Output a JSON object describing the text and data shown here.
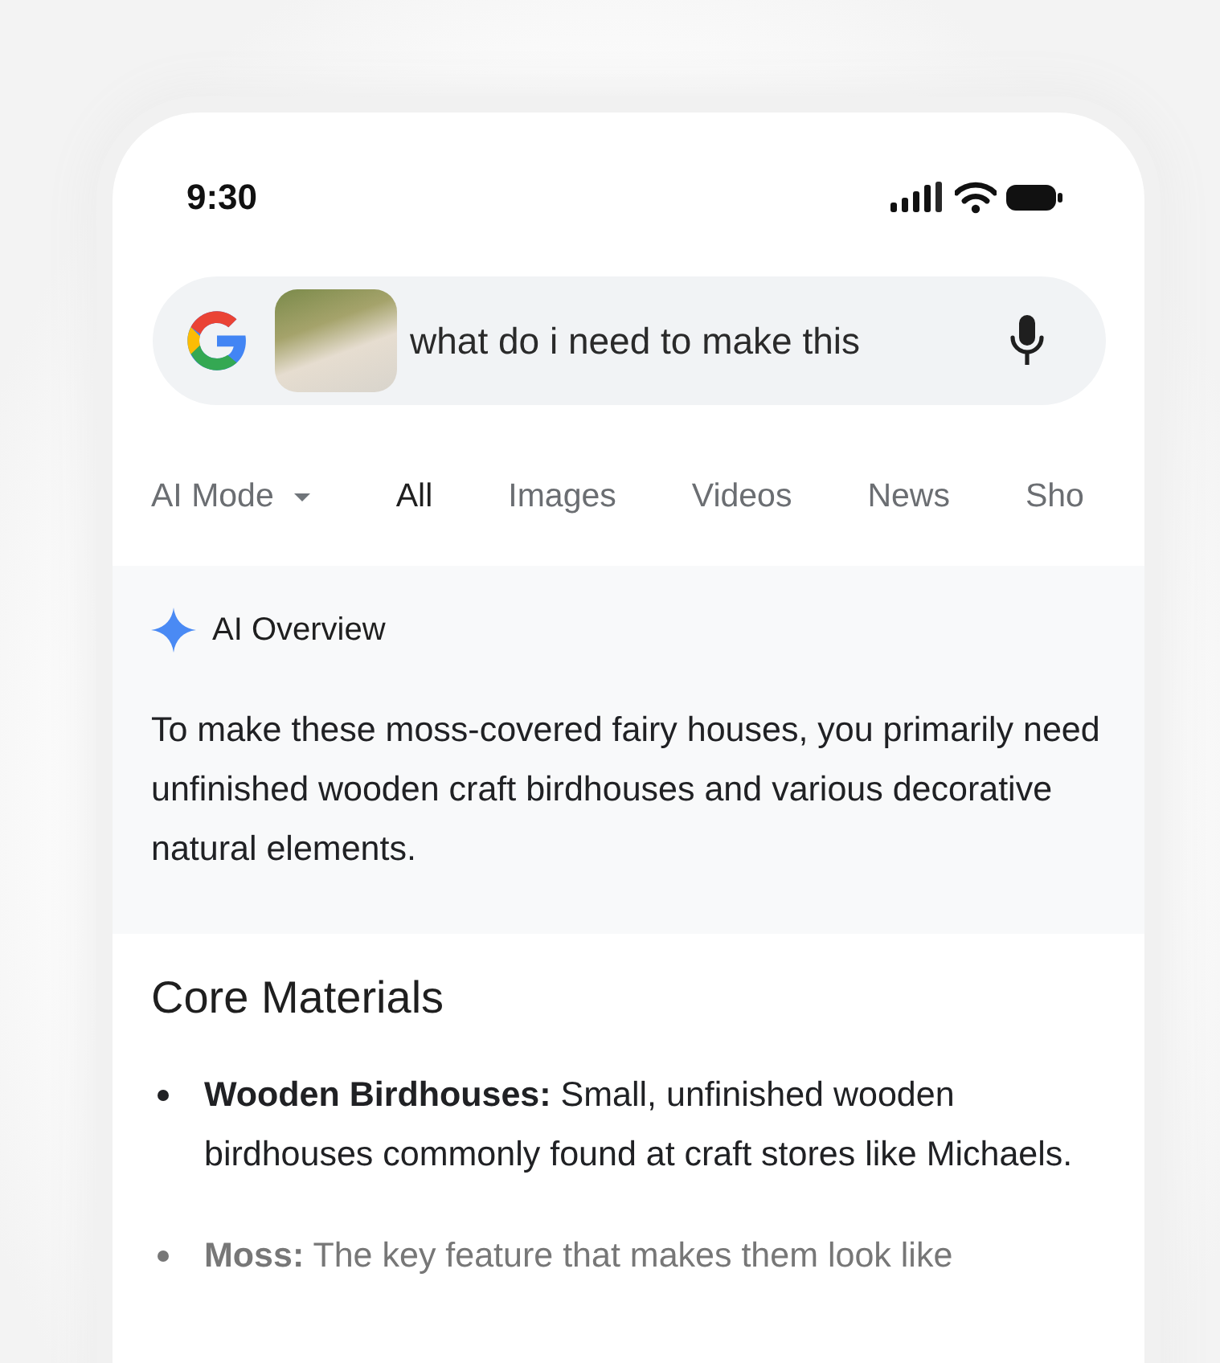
{
  "status_bar": {
    "time": "9:30"
  },
  "search": {
    "query": "what do i need to make this"
  },
  "tabs": [
    {
      "label": "AI Mode",
      "kind": "dropdown",
      "selected": false
    },
    {
      "label": "All",
      "kind": "tab",
      "selected": true
    },
    {
      "label": "Images",
      "kind": "tab",
      "selected": false
    },
    {
      "label": "Videos",
      "kind": "tab",
      "selected": false
    },
    {
      "label": "News",
      "kind": "tab",
      "selected": false
    },
    {
      "label": "Sho",
      "kind": "tab",
      "selected": false
    }
  ],
  "ai_overview": {
    "title": "AI Overview",
    "summary": "To make these moss-covered fairy houses, you primarily need unfinished wooden craft birdhouses and various decorative natural elements."
  },
  "section": {
    "heading": "Core Materials",
    "items": [
      {
        "text": "**Wooden Birdhouses:** Small, unfinished wooden birdhouses commonly found at craft stores like Michaels.",
        "faded": false
      },
      {
        "text": "**Moss:** The key feature that makes them look like",
        "faded": true
      }
    ]
  }
}
